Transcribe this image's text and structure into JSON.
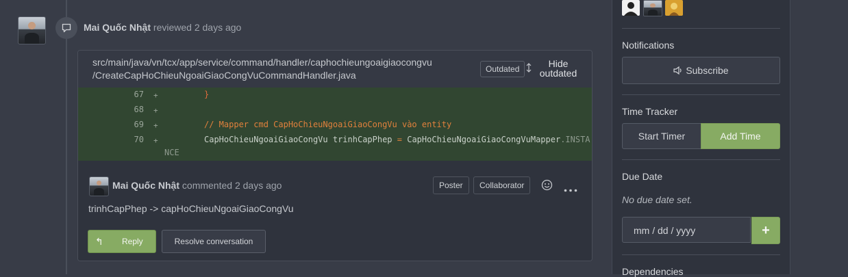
{
  "review": {
    "author": "Mai Quốc Nhật",
    "action": "reviewed",
    "time": "2 days ago"
  },
  "file": {
    "path_line1": "src/main/java/vn/tcx/app/service/command/handler/caphochieungoaigiaocongvu",
    "path_line2": "/CreateCapHoChieuNgoaiGiaoCongVuCommandHandler.java",
    "outdated_label": "Outdated",
    "hide_outdated_line1": "Hide",
    "hide_outdated_line2": "outdated"
  },
  "diff": [
    {
      "line": "67",
      "marker": "+",
      "code": "}"
    },
    {
      "line": "68",
      "marker": "+",
      "code": ""
    },
    {
      "line": "69",
      "marker": "+",
      "code": "// Mapper cmd CapHoChieuNgoaiGiaoCongVu vào entity"
    },
    {
      "line": "70",
      "marker": "+",
      "code_a": "CapHoChieuNgoaiGiaoCongVu trinhCapPhep ",
      "code_op": "=",
      "code_b": " CapHoChieuNgoaiGiaoCongVuMapper",
      "code_c": ".INSTA",
      "code_wrap": "NCE"
    }
  ],
  "comment": {
    "author": "Mai Quốc Nhật",
    "action": "commented",
    "time": "2 days ago",
    "badge_poster": "Poster",
    "badge_collaborator": "Collaborator",
    "body": "trinhCapPhep -> capHoChieuNgoaiGiaoCongVu",
    "reply_label": "Reply",
    "resolve_label": "Resolve conversation"
  },
  "sidebar": {
    "notifications_title": "Notifications",
    "subscribe_label": "Subscribe",
    "time_tracker_title": "Time Tracker",
    "start_timer_label": "Start Timer",
    "add_time_label": "Add Time",
    "due_date_title": "Due Date",
    "no_due_date": "No due date set.",
    "date_placeholder": "mm / dd / yyyy",
    "add_date_label": "+",
    "dependencies_title": "Dependencies"
  },
  "colors": {
    "accent_green": "#87ab63",
    "diff_added_bg": "#314631",
    "page_bg": "#383c47"
  }
}
